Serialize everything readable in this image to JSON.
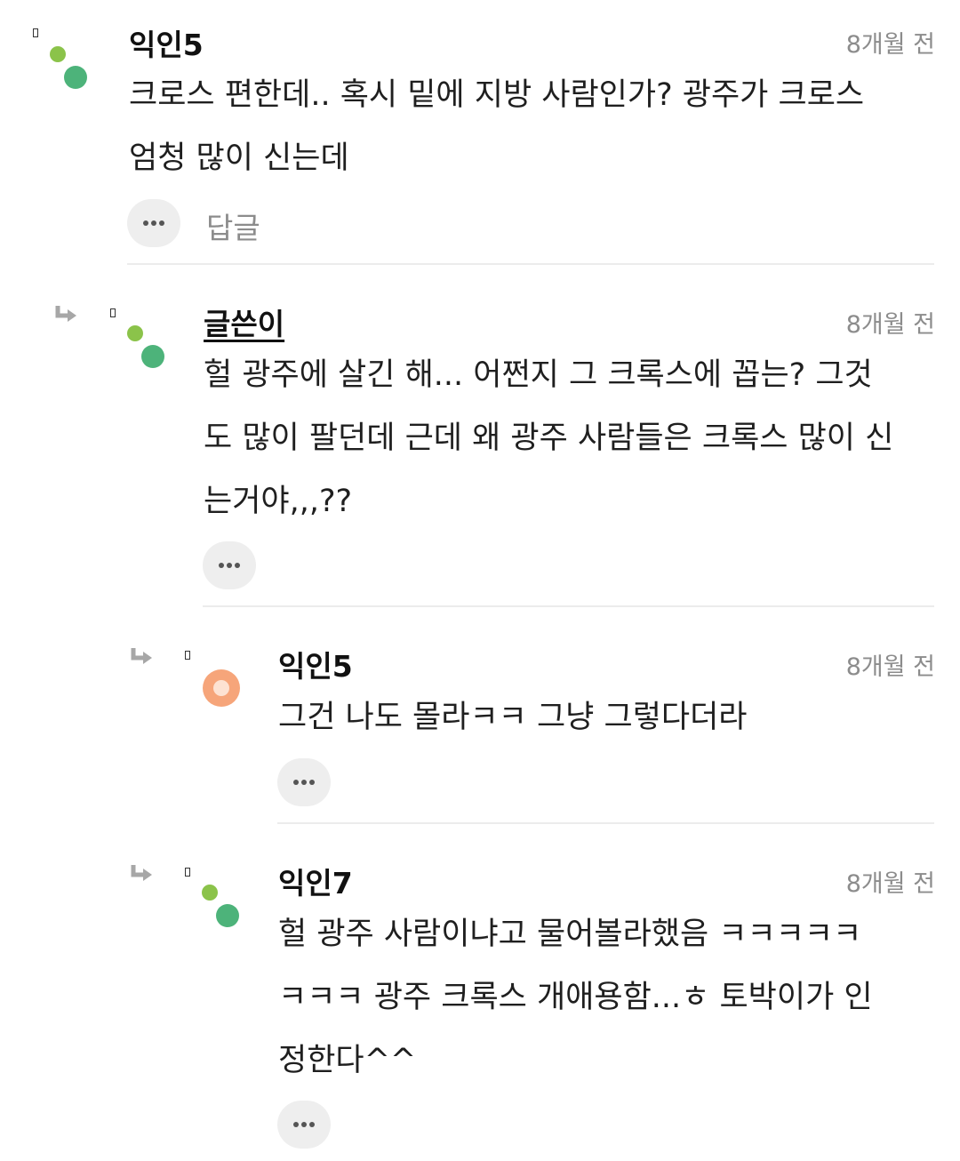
{
  "comments": [
    {
      "author": "익인5",
      "time": "8개월 전",
      "lines": [
        "크로스 편한데.. 혹시 밑에 지방 사람인가? 광주가 크로스",
        "엄청 많이 신는데"
      ],
      "reply_label": "답글",
      "avatar_icon": "two-dot-avatar-icon"
    },
    {
      "author": "글쓴이",
      "time": "8개월 전",
      "lines": [
        "헐 광주에 살긴 해... 어쩐지 그 크록스에 꼽는? 그것",
        "도 많이 팔던데 근데 왜 광주 사람들은 크록스 많이 신",
        "는거야,,,??"
      ],
      "avatar_icon": "two-dot-avatar-icon"
    },
    {
      "author": "익인5",
      "time": "8개월 전",
      "lines": [
        "그건 나도 몰라ㅋㅋ 그냥 그렇다더라"
      ],
      "avatar_icon": "orange-circle-avatar-icon"
    },
    {
      "author": "익인7",
      "time": "8개월 전",
      "lines": [
        "헐 광주 사람이냐고 물어볼라했음 ㅋㅋㅋㅋㅋ",
        "ㅋㅋㅋ 광주 크록스 개애용함...ㅎ 토박이가 인",
        "정한다^^"
      ],
      "avatar_icon": "two-dot-avatar-icon"
    }
  ],
  "colors": {
    "avatar_light_green": "#8bc34a",
    "avatar_green": "#4db37a",
    "avatar_orange": "#f6a57a",
    "timestamp": "#8c8c8c",
    "more_button_bg": "#eeeeee"
  }
}
